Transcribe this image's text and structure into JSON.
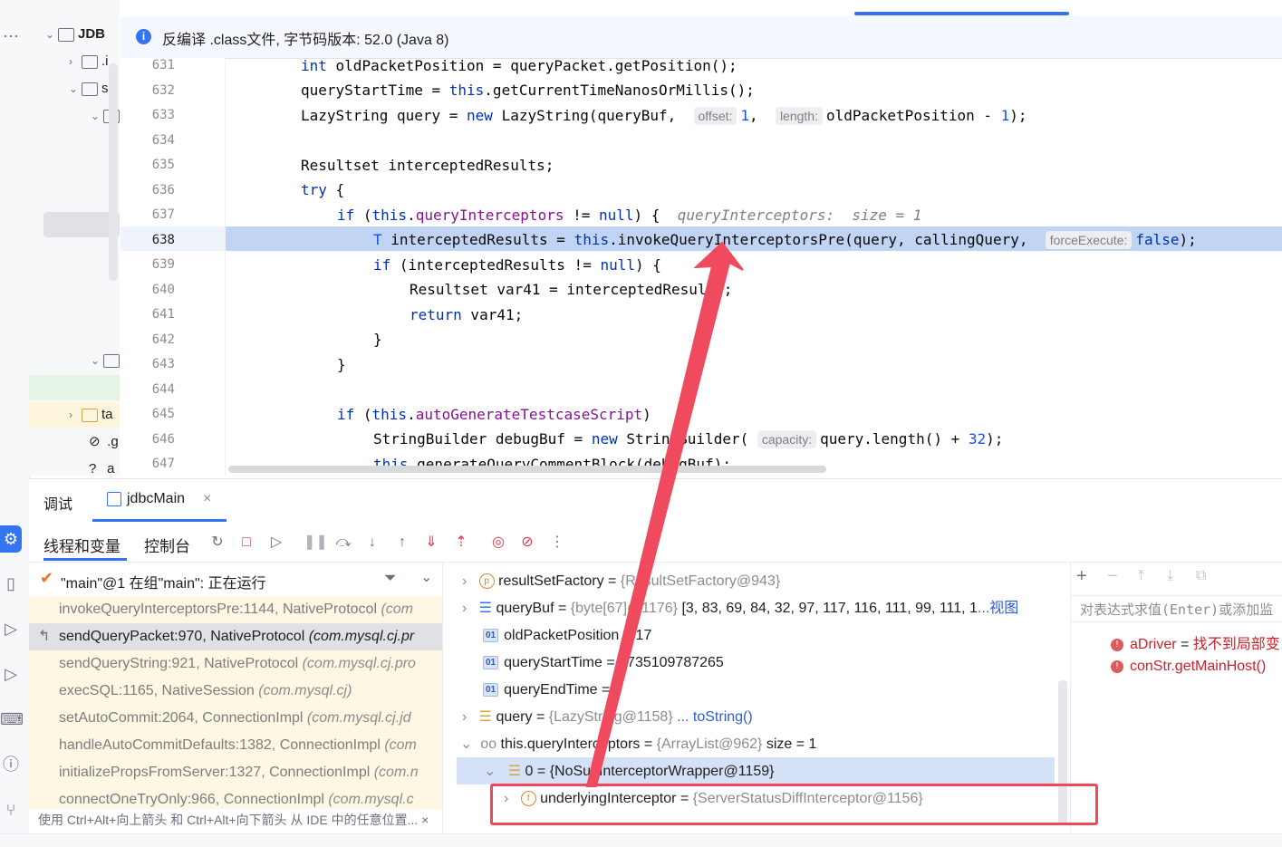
{
  "banner": {
    "text": "反编译 .class文件, 字节码版本: 52.0 (Java 8)"
  },
  "project": {
    "root": "JDB",
    "items": [
      ".i",
      "sr",
      "ta",
      ".g",
      "a"
    ]
  },
  "editor": {
    "line_numbers": [
      "631",
      "632",
      "633",
      "634",
      "635",
      "636",
      "637",
      "638",
      "639",
      "640",
      "641",
      "642",
      "643",
      "644",
      "645",
      "646",
      "647"
    ],
    "current_line": "638",
    "hints": {
      "offset": "offset:",
      "length": "length:",
      "forceExecute": "forceExecute:",
      "capacity": "capacity:"
    },
    "inline_value": "queryInterceptors:  size = 1"
  },
  "debug": {
    "tab_debug": "调试",
    "tab_session": "jdbcMain",
    "tab_threads": "线程和变量",
    "tab_console": "控制台",
    "thread_status": "\"main\"@1 在组\"main\": 正在运行",
    "frames": [
      {
        "method": "invokeQueryInterceptorsPre:1144, NativeProtocol",
        "pkg": "(com"
      },
      {
        "method": "sendQueryPacket:970, NativeProtocol",
        "pkg": "(com.mysql.cj.pr"
      },
      {
        "method": "sendQueryString:921, NativeProtocol",
        "pkg": "(com.mysql.cj.pro"
      },
      {
        "method": "execSQL:1165, NativeSession",
        "pkg": "(com.mysql.cj)"
      },
      {
        "method": "setAutoCommit:2064, ConnectionImpl",
        "pkg": "(com.mysql.cj.jd"
      },
      {
        "method": "handleAutoCommitDefaults:1382, ConnectionImpl",
        "pkg": "(com"
      },
      {
        "method": "initializePropsFromServer:1327, ConnectionImpl",
        "pkg": "(com.n"
      },
      {
        "method": "connectOneTryOnly:966, ConnectionImpl",
        "pkg": "(com.mysql.c"
      }
    ],
    "frames_hint": "使用 Ctrl+Alt+向上箭头 和 Ctrl+Alt+向下箭头 从 IDE 中的任意位置..."
  },
  "variables": [
    {
      "name": "resultSetFactory",
      "eq": " = ",
      "value": "{ResultSetFactory@943}",
      "extra": ""
    },
    {
      "name": "queryBuf",
      "eq": " = ",
      "value": "{byte[67]@1176}",
      "extra": " [3, 83, 69, 84, 32, 97, 117, 116, 111, 99, 111, 1",
      "link": "...视图"
    },
    {
      "name": "oldPacketPosition",
      "eq": " = ",
      "value": "17"
    },
    {
      "name": "queryStartTime",
      "eq": " = ",
      "value": "1735109787265"
    },
    {
      "name": "queryEndTime",
      "eq": " = ",
      "value": "0"
    },
    {
      "name": "query",
      "eq": " = ",
      "value": "{LazyString@1158}",
      "link": " ... toString()"
    },
    {
      "name": "this.queryInterceptors",
      "eq": " = ",
      "value": "{ArrayList@962}",
      "extra": "  size = 1"
    },
    {
      "name": "0",
      "eq": " = ",
      "value": "{NoSubInterceptorWrapper@1159}"
    },
    {
      "name": "underlyingInterceptor",
      "eq": " = ",
      "value": "{ServerStatusDiffInterceptor@1156}"
    }
  ],
  "watches": {
    "placeholder": "对表达式求值(Enter)或添加监",
    "items": [
      {
        "name": "aDriver",
        "eq": " = ",
        "value": "找不到局部变"
      },
      {
        "name": "conStr.getMainHost()",
        "eq": "",
        "value": ""
      }
    ]
  },
  "colors": {
    "highlight": "#c2d4f3",
    "annotation": "#f0485b",
    "accent": "#3574f0"
  }
}
